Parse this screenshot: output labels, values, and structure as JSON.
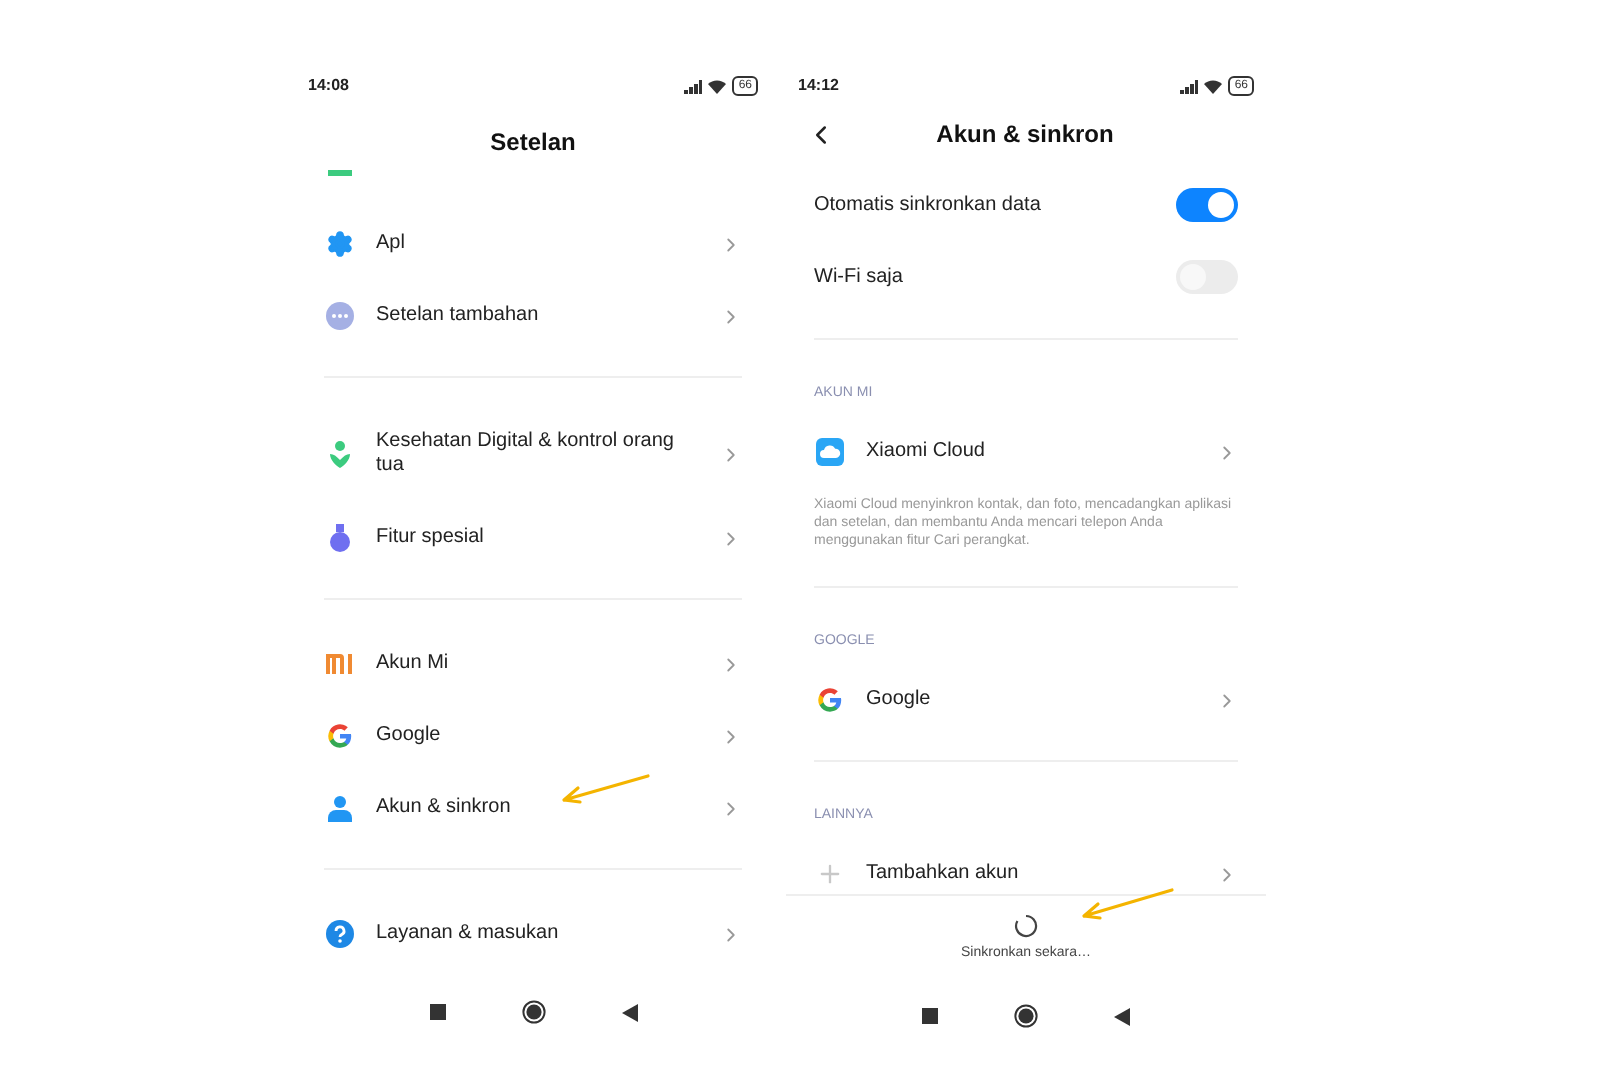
{
  "left": {
    "status": {
      "time": "14:08",
      "battery": "66"
    },
    "title": "Setelan",
    "groups": [
      [
        {
          "label": "Apl"
        },
        {
          "label": "Setelan tambahan"
        }
      ],
      [
        {
          "label": "Kesehatan Digital & kontrol orang tua"
        },
        {
          "label": "Fitur spesial"
        }
      ],
      [
        {
          "label": "Akun Mi"
        },
        {
          "label": "Google"
        },
        {
          "label": "Akun & sinkron"
        }
      ],
      [
        {
          "label": "Layanan & masukan"
        }
      ]
    ]
  },
  "right": {
    "status": {
      "time": "14:12",
      "battery": "66"
    },
    "title": "Akun & sinkron",
    "toggles": [
      {
        "label": "Otomatis sinkronkan data",
        "on": true
      },
      {
        "label": "Wi-Fi saja",
        "on": false
      }
    ],
    "sections": [
      {
        "heading": "AKUN MI",
        "items": [
          {
            "label": "Xiaomi Cloud"
          }
        ],
        "note": "Xiaomi Cloud menyinkron kontak, dan foto, mencadangkan aplikasi dan setelan, dan membantu Anda mencari telepon Anda menggunakan fitur Cari perangkat."
      },
      {
        "heading": "GOOGLE",
        "items": [
          {
            "label": "Google"
          }
        ]
      },
      {
        "heading": "LAINNYA",
        "items": [
          {
            "label": "Tambahkan akun"
          }
        ]
      }
    ],
    "sync_button": "Sinkronkan sekara…"
  }
}
